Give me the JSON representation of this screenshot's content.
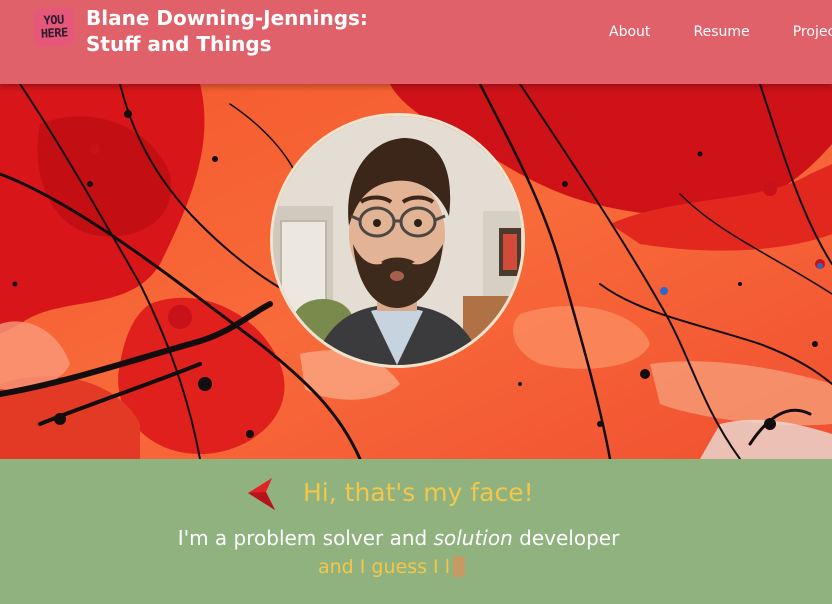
{
  "header": {
    "logo": {
      "line1": "YOU",
      "line2": "HERE"
    },
    "title_line1": "Blane Downing-Jennings:",
    "title_line2": "Stuff and Things",
    "nav": [
      "About",
      "Resume",
      "Projects"
    ]
  },
  "intro": {
    "greeting": "Hi, that's my face!",
    "tagline_pre": "I'm a problem solver and ",
    "tagline_em": "solution",
    "tagline_post": " developer",
    "typed_text": "and I guess I l"
  },
  "colors": {
    "header_bg": "#e0616a",
    "intro_bg": "#8fb27f",
    "accent_yellow": "#f4c64a",
    "arrow_red": "#e32222",
    "cursor": "#c79a65"
  }
}
